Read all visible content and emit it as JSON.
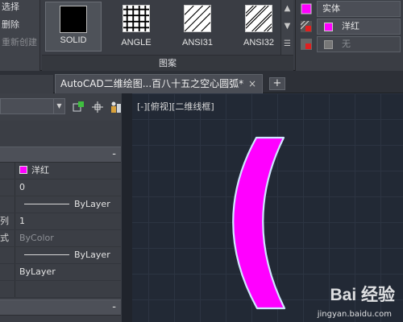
{
  "ribbon_left": {
    "items": [
      "选择",
      "删除",
      "重新创建"
    ]
  },
  "patterns": [
    {
      "label": "SOLID",
      "selected": true
    },
    {
      "label": "ANGLE",
      "selected": false
    },
    {
      "label": "ANSI31",
      "selected": false
    },
    {
      "label": "ANSI32",
      "selected": false
    }
  ],
  "pattern_panel_title": "图案",
  "ribbon_right": {
    "type_value": "实体",
    "color_value": "洋红",
    "background_value": "无",
    "color_hex": "#ff00ff"
  },
  "tabs": {
    "active": "AutoCAD二维绘图...百八十五之空心圆弧*",
    "close": "×",
    "add": "+"
  },
  "viewport": {
    "label": "[-][俯视][二维线框]"
  },
  "properties": {
    "rows": [
      {
        "key": "",
        "value": "洋红",
        "swatch": true
      },
      {
        "key": "",
        "value": "0"
      },
      {
        "key": "",
        "value": "ByLayer",
        "line": true
      },
      {
        "key": "列",
        "value": "1"
      },
      {
        "key": "式",
        "value": "ByColor",
        "dim": true
      },
      {
        "key": "",
        "value": "ByLayer",
        "line": true
      },
      {
        "key": "",
        "value": "ByLayer"
      }
    ],
    "cat_toggle": "-"
  },
  "watermark": {
    "brand": "Bai  经验",
    "url": "jingyan.baidu.com"
  }
}
